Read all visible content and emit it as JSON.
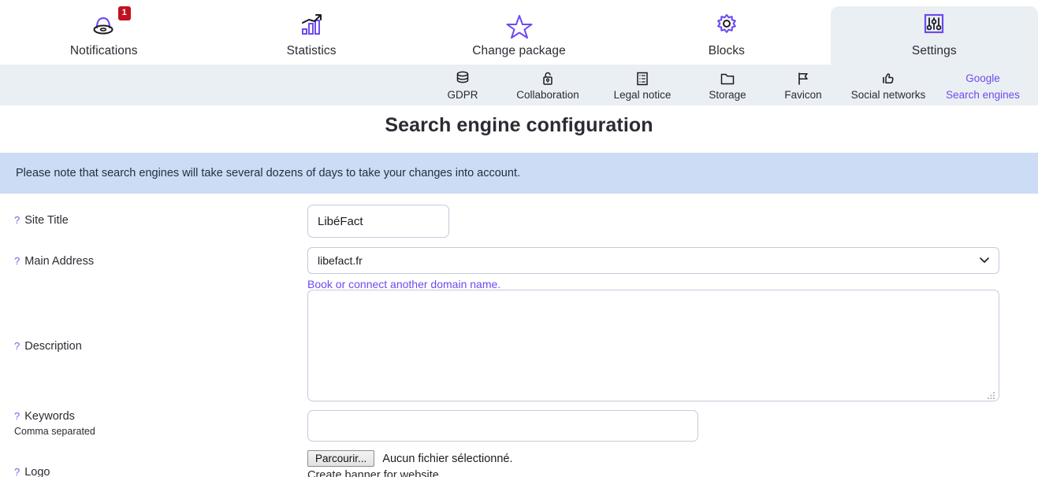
{
  "colors": {
    "accent": "#6d4bf0",
    "active_tab_bg": "#eaeff3",
    "notice_bg": "#ccdcf5",
    "badge_bg": "#c1121f"
  },
  "topnav": {
    "items": [
      {
        "label": "Notifications",
        "icon": "bell-icon",
        "badge": "1",
        "active": false
      },
      {
        "label": "Statistics",
        "icon": "bar-chart-trend-icon",
        "badge": "",
        "active": false
      },
      {
        "label": "Change package",
        "icon": "star-icon",
        "badge": "",
        "active": false
      },
      {
        "label": "Blocks",
        "icon": "gear-icon",
        "badge": "",
        "active": false
      },
      {
        "label": "Settings",
        "icon": "sliders-icon",
        "badge": "",
        "active": true
      }
    ]
  },
  "subnav": {
    "items": [
      {
        "label": "GDPR",
        "icon": "database-icon",
        "icon_text": "",
        "active": false
      },
      {
        "label": "Collaboration",
        "icon": "lock-open-icon",
        "icon_text": "",
        "active": false
      },
      {
        "label": "Legal notice",
        "icon": "document-list-icon",
        "icon_text": "",
        "active": false
      },
      {
        "label": "Storage",
        "icon": "folder-icon",
        "icon_text": "",
        "active": false
      },
      {
        "label": "Favicon",
        "icon": "flag-icon",
        "icon_text": "",
        "active": false
      },
      {
        "label": "Social networks",
        "icon": "thumbs-up-icon",
        "icon_text": "",
        "active": false
      },
      {
        "label": "Search engines",
        "icon": "google-text-icon",
        "icon_text": "Google",
        "active": true
      }
    ]
  },
  "page": {
    "title": "Search engine configuration",
    "notice": "Please note that search engines will take several dozens of days to take your changes into account."
  },
  "form": {
    "help_marker": "?",
    "site_title": {
      "label": "Site Title",
      "value": "LibéFact",
      "placeholder": ""
    },
    "main_address": {
      "label": "Main Address",
      "selected": "libefact.fr",
      "options": [
        "libefact.fr"
      ],
      "link": "Book or connect another domain name."
    },
    "description": {
      "label": "Description",
      "value": "",
      "placeholder": ""
    },
    "keywords": {
      "label": "Keywords",
      "hint": "Comma separated",
      "value": "",
      "placeholder": ""
    },
    "logo": {
      "label": "Logo",
      "button": "Parcourir...",
      "file_status": "Aucun fichier sélectionné.",
      "caption": "Create banner for website"
    }
  }
}
